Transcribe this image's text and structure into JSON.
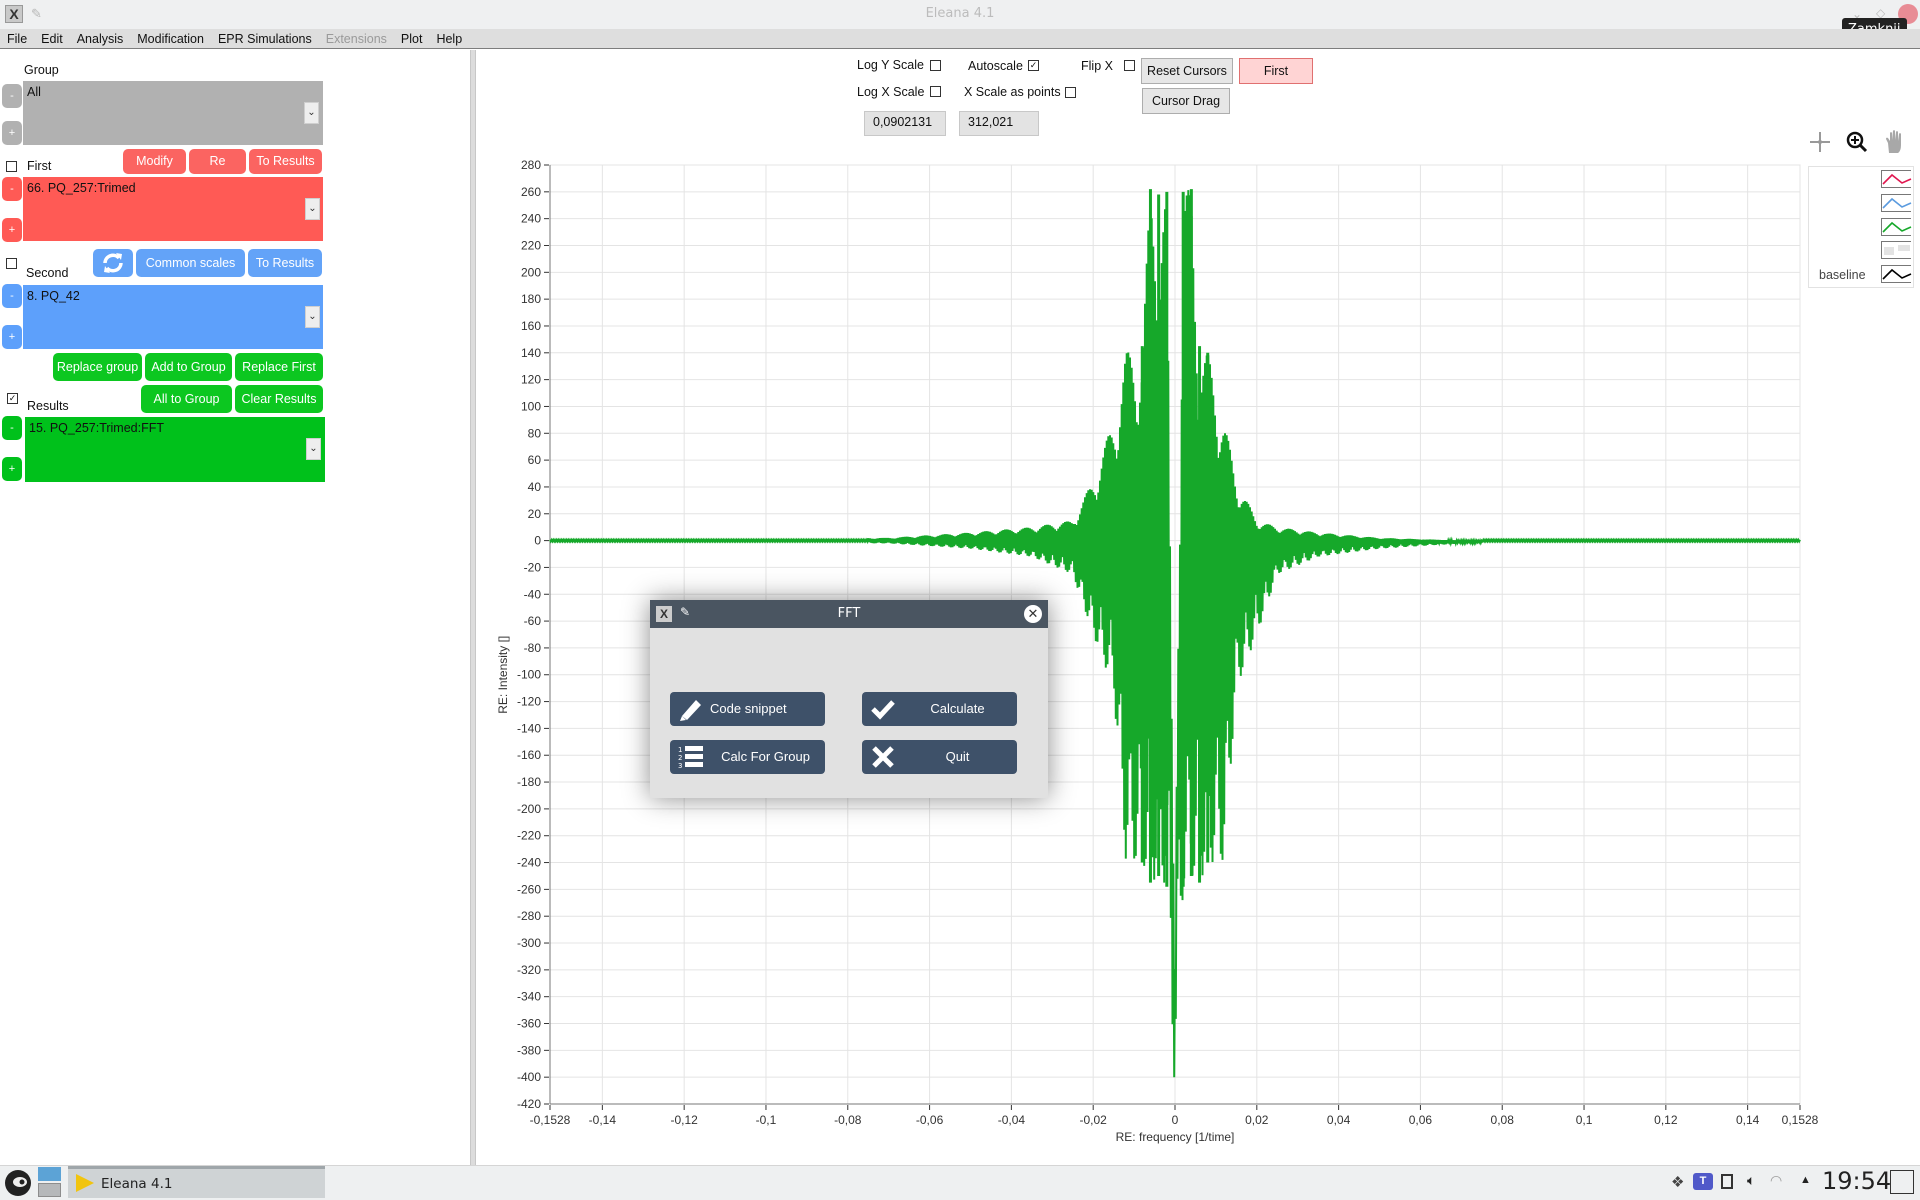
{
  "window": {
    "title": "Eleana 4.1",
    "tooltip": "Zamknij"
  },
  "menu": [
    "File",
    "Edit",
    "Analysis",
    "Modification",
    "EPR Simulations",
    "Extensions",
    "Plot",
    "Help"
  ],
  "menu_disabled": [
    "Extensions"
  ],
  "left": {
    "group": {
      "label": "Group",
      "value": "All"
    },
    "first": {
      "label": "First",
      "checked": false,
      "value": "66.  PQ_257:Trimed",
      "buttons": [
        "Modify",
        "Re",
        "To Results"
      ]
    },
    "second": {
      "label": "Second",
      "checked": false,
      "value": "8.  PQ_42",
      "buttons": [
        "Common scales",
        "To Results"
      ]
    },
    "transfer_buttons": [
      "Replace group",
      "Add to Group",
      "Replace First"
    ],
    "results": {
      "label": "Results",
      "checked": true,
      "value": "15.  PQ_257:Trimed:FFT",
      "buttons": [
        "All to Group",
        "Clear Results"
      ]
    },
    "minus": "-",
    "plus": "+"
  },
  "plot_controls": {
    "log_y": {
      "label": "Log Y Scale",
      "checked": false
    },
    "log_x": {
      "label": "Log X Scale",
      "checked": false
    },
    "autoscale": {
      "label": "Autoscale",
      "checked": true
    },
    "x_points": {
      "label": "X Scale as points",
      "checked": false
    },
    "flip_x": {
      "label": "Flip X",
      "checked": false
    },
    "reset_cursors": "Reset Cursors",
    "cursor_drag": "Cursor Drag",
    "cursor_target": "First",
    "cursor_x": "0,0902131",
    "cursor_y": "312,021"
  },
  "legend": {
    "entries": [
      {
        "label": "",
        "color": "#e0174f"
      },
      {
        "label": "",
        "color": "#5b9bdf"
      },
      {
        "label": "",
        "color": "#16a82a"
      },
      {
        "label": "",
        "color": "#d8d8d8"
      },
      {
        "label": "baseline",
        "color": "#000000"
      }
    ]
  },
  "dialog": {
    "title": "FFT",
    "buttons": {
      "code_snippet": "Code snippet",
      "calculate": "Calculate",
      "calc_for_group": "Calc For Group",
      "quit": "Quit"
    }
  },
  "taskbar": {
    "app_label": "Eleana 4.1",
    "clock": "19:54"
  },
  "chart_data": {
    "type": "line",
    "title": "",
    "xlabel": "RE: frequency [1/time]",
    "ylabel": "RE: Intensity []",
    "xlim": [
      -0.1528,
      0.1528
    ],
    "ylim": [
      -420,
      280
    ],
    "grid": true,
    "x_ticks": [
      -0.1528,
      -0.14,
      -0.12,
      -0.1,
      -0.08,
      -0.06,
      -0.04,
      -0.02,
      0,
      0.02,
      0.04,
      0.06,
      0.08,
      0.1,
      0.12,
      0.14,
      0.1528
    ],
    "x_tick_labels": [
      "-0,1528",
      "-0,14",
      "-0,12",
      "-0,1",
      "-0,08",
      "-0,06",
      "-0,04",
      "-0,02",
      "0",
      "0,02",
      "0,04",
      "0,06",
      "0,08",
      "0,1",
      "0,12",
      "0,14",
      "0,1528"
    ],
    "y_ticks": [
      280,
      260,
      240,
      220,
      200,
      180,
      160,
      140,
      120,
      100,
      80,
      60,
      40,
      20,
      0,
      -20,
      -40,
      -60,
      -80,
      -100,
      -120,
      -140,
      -160,
      -180,
      -200,
      -220,
      -240,
      -260,
      -280,
      -300,
      -320,
      -340,
      -360,
      -380,
      -400,
      -420
    ],
    "series": [
      {
        "name": "15. PQ_257:Trimed:FFT",
        "color": "#16a82a",
        "description": "symmetric oscillating spectrum centered at 0; near-zero baseline at edges, growing oscillation toward center",
        "key_points": {
          "x": [
            -0.1528,
            -0.07,
            -0.05,
            -0.035,
            -0.025,
            -0.02,
            -0.015,
            -0.012,
            -0.008,
            -0.006,
            -0.004,
            -0.002,
            0,
            0.002,
            0.004,
            0.006,
            0.008,
            0.012,
            0.015,
            0.02,
            0.025,
            0.035,
            0.05,
            0.07,
            0.1528
          ],
          "y": [
            0,
            2,
            6,
            10,
            15,
            45,
            90,
            140,
            145,
            262,
            258,
            260,
            -420,
            260,
            262,
            145,
            140,
            90,
            45,
            15,
            10,
            6,
            2,
            0,
            0
          ],
          "min_envelope": [
            0,
            -2,
            -6,
            -12,
            -25,
            -70,
            -110,
            -240,
            -240,
            -255,
            -250,
            -258,
            -420,
            -258,
            -250,
            -255,
            -240,
            -240,
            -110,
            -70,
            -25,
            -12,
            -6,
            -2,
            0
          ]
        }
      }
    ]
  }
}
